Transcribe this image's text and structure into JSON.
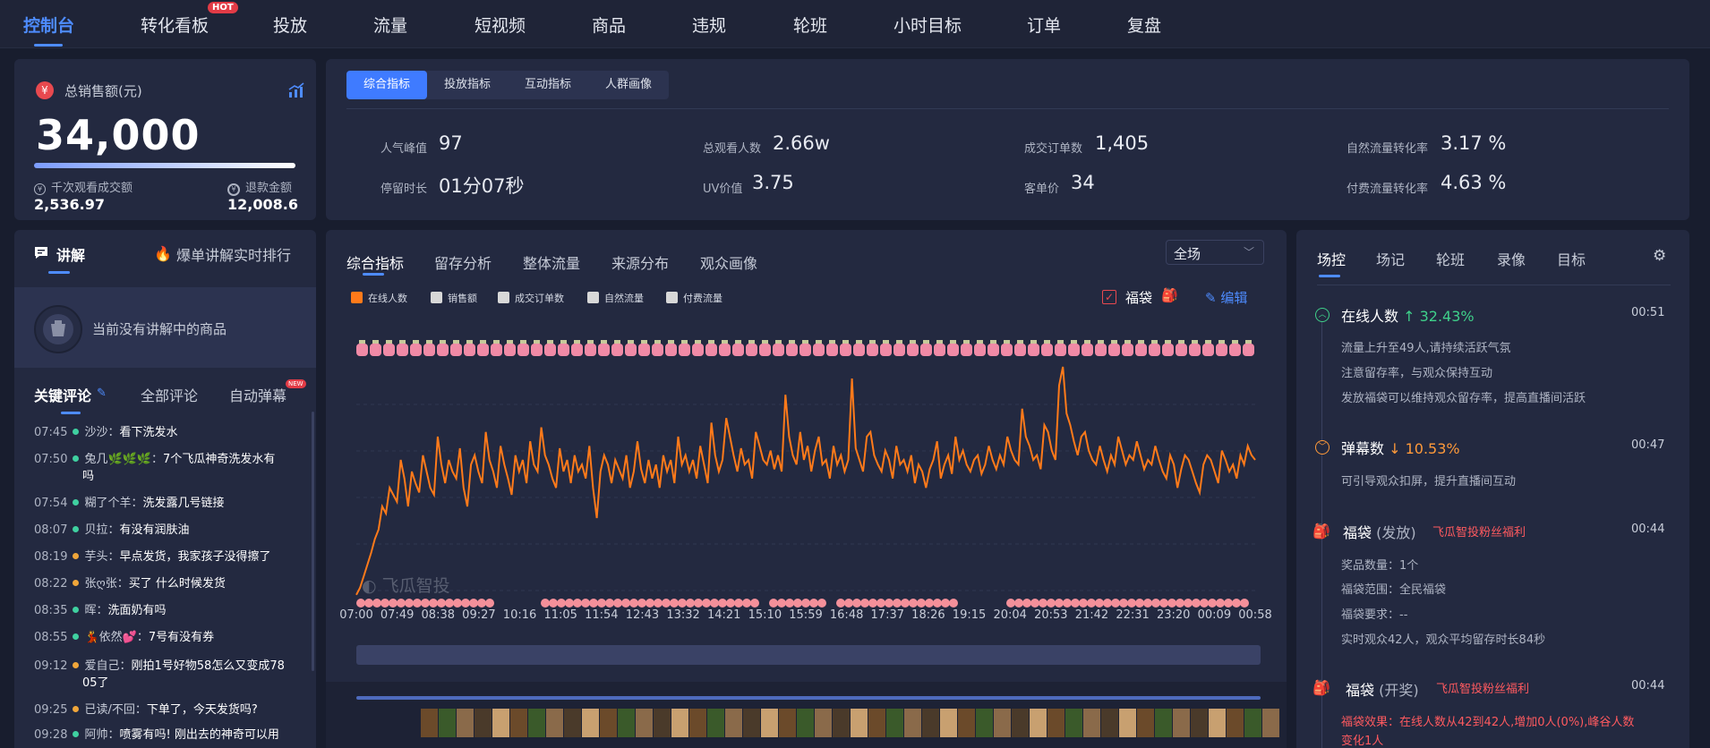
{
  "nav": {
    "items": [
      "控制台",
      "转化看板",
      "投放",
      "流量",
      "短视频",
      "商品",
      "违规",
      "轮班",
      "小时目标",
      "订单",
      "复盘"
    ],
    "hot_badge": "HOT"
  },
  "sales": {
    "title": "总销售额(元)",
    "value": "34,000",
    "left_label": "千次观看成交额",
    "left_value": "2,536.97",
    "right_label": "退款金额",
    "right_value": "12,008.6"
  },
  "metrics": {
    "tabs": [
      "综合指标",
      "投放指标",
      "互动指标",
      "人群画像"
    ],
    "items": [
      {
        "label": "人气峰值",
        "value": "97"
      },
      {
        "label": "总观看人数",
        "value": "2.66w"
      },
      {
        "label": "成交订单数",
        "value": "1,405"
      },
      {
        "label": "自然流量转化率",
        "value": "3.17 %"
      },
      {
        "label": "停留时长",
        "value": "01分07秒"
      },
      {
        "label": "UV价值",
        "value": "3.75"
      },
      {
        "label": "客单价",
        "value": "34"
      },
      {
        "label": "付费流量转化率",
        "value": "4.63 %"
      }
    ]
  },
  "explain": {
    "tab": "讲解",
    "rank_link": "爆单讲解实时排行",
    "empty": "当前没有讲解中的商品"
  },
  "comment_tabs": {
    "key": "关键评论",
    "all": "全部评论",
    "auto": "自动弹幕",
    "new_badge": "NEW"
  },
  "comments": [
    {
      "time": "07:45",
      "user": "沙沙",
      "text": "看下洗发水",
      "dot": "#3fd0a0"
    },
    {
      "time": "07:50",
      "user": "兔几🌿🌿🌿",
      "text": "7个飞瓜神奇洗发水有",
      "text2": "吗",
      "dot": "#3fd0a0"
    },
    {
      "time": "07:54",
      "user": "糊了个羊",
      "text": "洗发露几号链接",
      "dot": "#3fd0a0"
    },
    {
      "time": "08:07",
      "user": "贝拉",
      "text": "有没有润肤油",
      "dot": "#3fd0a0"
    },
    {
      "time": "08:19",
      "user": "芋头",
      "text": "早点发货，我家孩子没得擦了",
      "dot": "#f0a63a"
    },
    {
      "time": "08:22",
      "user": "张ღ张",
      "text": "买了 什么时候发货",
      "dot": "#f0a63a"
    },
    {
      "time": "08:35",
      "user": "晖",
      "text": "洗面奶有吗",
      "dot": "#3fd0a0"
    },
    {
      "time": "08:55",
      "user": "💃依然💕",
      "text": "7号有没有券",
      "dot": "#3fd0a0"
    },
    {
      "time": "09:12",
      "user": "爱自己",
      "text": "刚拍1号好物58怎么又变成78",
      "text2": "05了",
      "dot": "#f0a63a"
    },
    {
      "time": "09:25",
      "user": "已读/不回",
      "text": "下单了，今天发货吗?",
      "dot": "#f0a63a"
    },
    {
      "time": "09:28",
      "user": "阿帅",
      "text": "喷雾有吗! 刚出去的神奇可以用",
      "dot": "#3fd0a0"
    }
  ],
  "chart_panel": {
    "tabs": [
      "综合指标",
      "留存分析",
      "整体流量",
      "来源分布",
      "观众画像"
    ],
    "scope": "全场",
    "legend": [
      {
        "name": "在线人数",
        "color": "#ff7a1a",
        "on": true
      },
      {
        "name": "销售额",
        "color": "#d8d8d8",
        "on": false
      },
      {
        "name": "成交订单数",
        "color": "#d8d8d8",
        "on": false
      },
      {
        "name": "自然流量",
        "color": "#d8d8d8",
        "on": false
      },
      {
        "name": "付费流量",
        "color": "#d8d8d8",
        "on": false
      }
    ],
    "fudai_label": "福袋",
    "edit_label": "编辑",
    "watermark": "飞瓜智投"
  },
  "chart_data": {
    "type": "line",
    "series": [
      {
        "name": "在线人数",
        "color": "#ff7a1a"
      }
    ],
    "x_ticks": [
      "07:00",
      "07:49",
      "08:38",
      "09:27",
      "10:16",
      "11:05",
      "11:54",
      "12:43",
      "13:32",
      "14:21",
      "15:10",
      "15:59",
      "16:48",
      "17:37",
      "18:26",
      "19:15",
      "20:04",
      "20:53",
      "21:42",
      "22:31",
      "23:20",
      "00:09",
      "00:58"
    ],
    "values": [
      2,
      5,
      10,
      15,
      20,
      26,
      30,
      40,
      37,
      48,
      45,
      42,
      60,
      52,
      40,
      55,
      50,
      46,
      62,
      55,
      48,
      45,
      70,
      58,
      50,
      60,
      55,
      52,
      65,
      48,
      40,
      58,
      62,
      55,
      50,
      72,
      60,
      55,
      48,
      66,
      58,
      52,
      45,
      62,
      55,
      60,
      50,
      68,
      58,
      55,
      74,
      62,
      58,
      52,
      48,
      65,
      55,
      60,
      50,
      62,
      55,
      58,
      52,
      66,
      48,
      35,
      55,
      62,
      58,
      50,
      60,
      56,
      52,
      62,
      48,
      55,
      68,
      56,
      50,
      60,
      52,
      58,
      48,
      62,
      55,
      60,
      50,
      70,
      58,
      62,
      55,
      60,
      52,
      66,
      58,
      50,
      76,
      62,
      55,
      60,
      78,
      70,
      62,
      55,
      65,
      58,
      60,
      52,
      72,
      66,
      60,
      58,
      64,
      56,
      62,
      55,
      88,
      70,
      62,
      58,
      72,
      60,
      66,
      55,
      64,
      70,
      58,
      60,
      52,
      66,
      58,
      62,
      55,
      60,
      95,
      65,
      60,
      55,
      70,
      72,
      62,
      58,
      55,
      64,
      60,
      52,
      66,
      58,
      60,
      55,
      62,
      50,
      58,
      55,
      48,
      56,
      60,
      68,
      52,
      58,
      62,
      54,
      70,
      60,
      64,
      58,
      55,
      60,
      62,
      54,
      58,
      66,
      60,
      56,
      62,
      58,
      70,
      64,
      60,
      58,
      82,
      70,
      66,
      60,
      62,
      56,
      75,
      72,
      64,
      60,
      92,
      100,
      80,
      75,
      68,
      62,
      70,
      72,
      64,
      60,
      58,
      66,
      60,
      55,
      62,
      58,
      70,
      64,
      58,
      62,
      60,
      68,
      62,
      56,
      60,
      58,
      66,
      60,
      55,
      52,
      62,
      58,
      48,
      56,
      62,
      60,
      55,
      50,
      46,
      58,
      62,
      60,
      55,
      50,
      64,
      60,
      55,
      58,
      52,
      62,
      58,
      66,
      62,
      60
    ]
  },
  "right_panel": {
    "tabs": [
      "场控",
      "场记",
      "轮班",
      "录像",
      "目标"
    ],
    "events": [
      {
        "title": "在线人数",
        "change": "↑ 32.43%",
        "change_color": "#3fd08a",
        "time": "00:51",
        "lines": [
          "流量上升至49人,请持续活跃气氛",
          "注意留存率，与观众保持互动",
          "发放福袋可以维持观众留存率，提高直播间活跃"
        ]
      },
      {
        "title": "弹幕数",
        "change": "↓ 10.53%",
        "change_color": "#ff9a3a",
        "time": "00:47",
        "lines": [
          "可引导观众扣屏，提升直播间互动"
        ]
      },
      {
        "title": "福袋",
        "sub": "(发放)",
        "tag": "飞瓜智投粉丝福利",
        "time": "00:44",
        "lines": [
          "奖品数量：1个",
          "福袋范围：全民福袋",
          "福袋要求：--",
          "实时观众42人，观众平均留存时长84秒"
        ]
      },
      {
        "title": "福袋",
        "sub": "(开奖)",
        "tag": "飞瓜智投粉丝福利",
        "time": "00:44",
        "lines": [
          "福袋效果：在线人数从42到42人,增加0人(0%),峰谷人数",
          "变化1人"
        ]
      }
    ]
  }
}
